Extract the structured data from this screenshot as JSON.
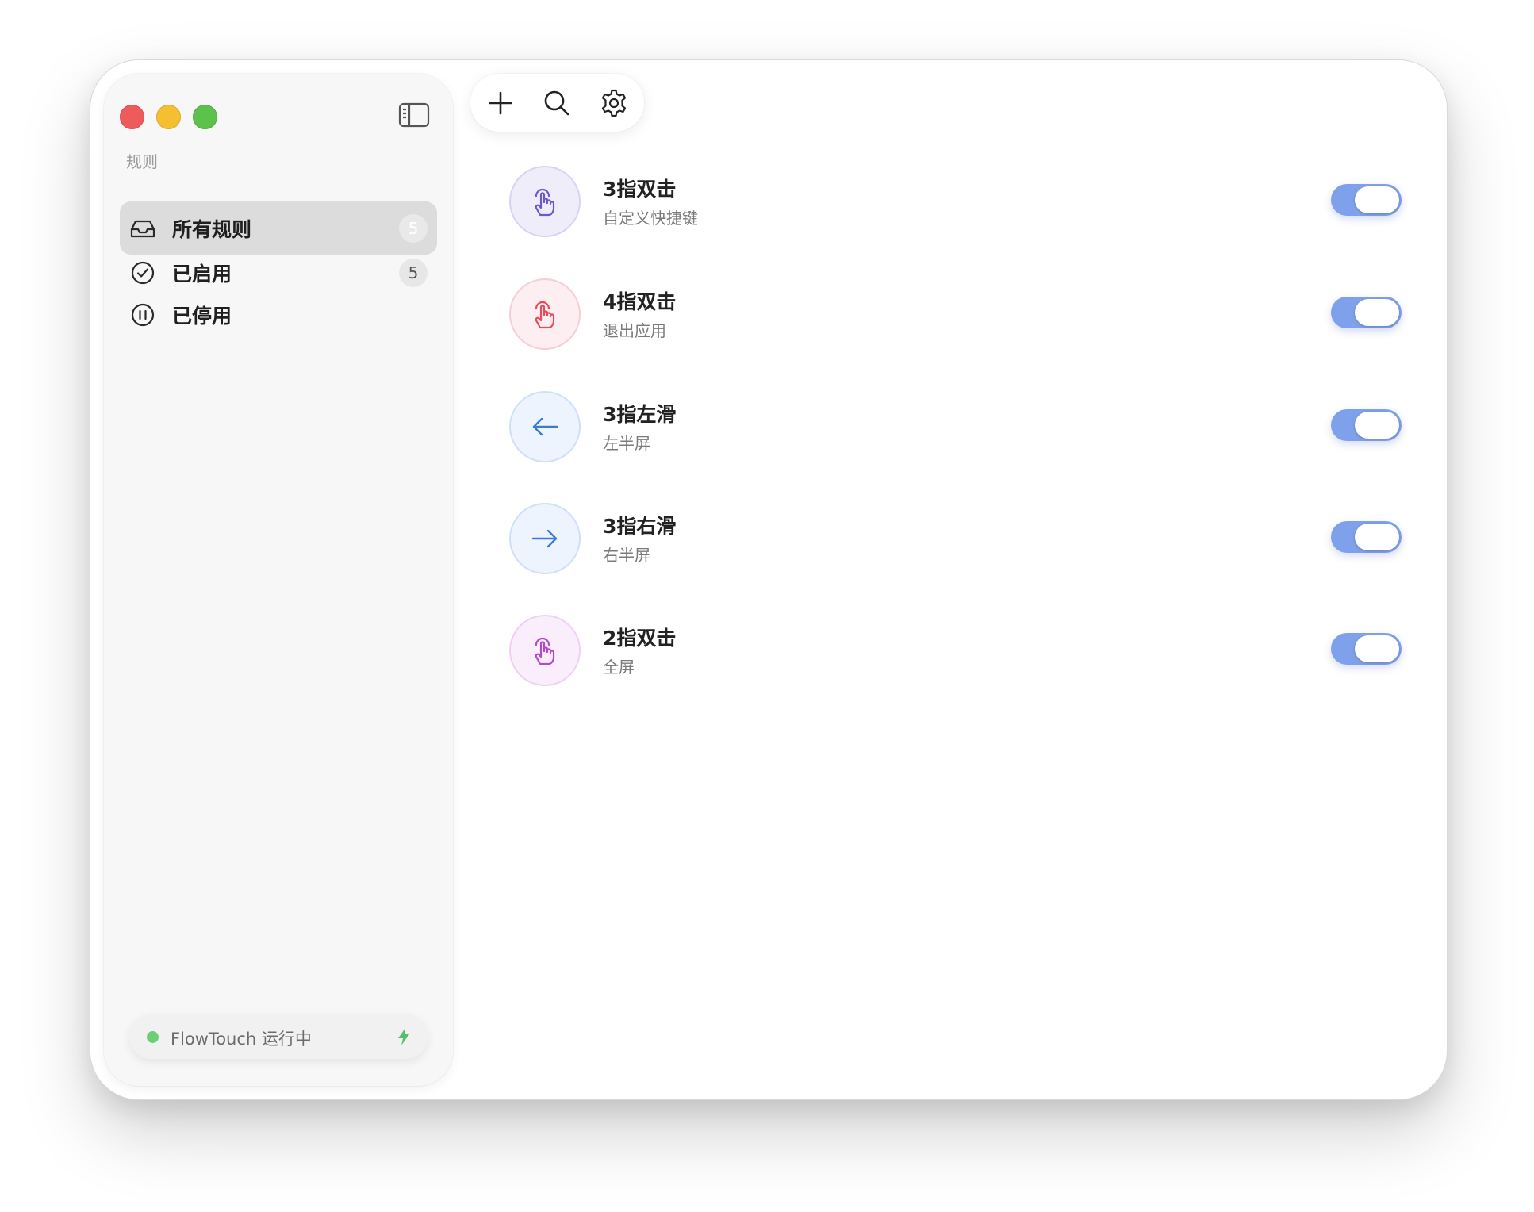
{
  "sidebar": {
    "section_label": "规则",
    "items": [
      {
        "label": "所有规则",
        "count": "5",
        "icon": "tray-icon"
      },
      {
        "label": "已启用",
        "count": "5",
        "icon": "check-circle-icon"
      },
      {
        "label": "已停用",
        "count": "",
        "icon": "pause-circle-icon"
      }
    ],
    "status": {
      "text": "FlowTouch 运行中",
      "dot_color": "#6bcf73"
    }
  },
  "toolbar": {
    "add_icon": "plus-icon",
    "search_icon": "search-icon",
    "settings_icon": "gear-icon"
  },
  "rules": [
    {
      "title": "3指双击",
      "subtitle": "自定义快捷键",
      "icon": "hand-tap-icon",
      "color": "#6a5acd",
      "bg": "#f0edfb",
      "border": "#d9d2f3",
      "enabled": true
    },
    {
      "title": "4指双击",
      "subtitle": "退出应用",
      "icon": "hand-tap-icon",
      "color": "#e64a5e",
      "bg": "#fdeff1",
      "border": "#f5cfd5",
      "enabled": true
    },
    {
      "title": "3指左滑",
      "subtitle": "左半屏",
      "icon": "arrow-left-icon",
      "color": "#3a7bd5",
      "bg": "#eef4fd",
      "border": "#cfe0f7",
      "enabled": true
    },
    {
      "title": "3指右滑",
      "subtitle": "右半屏",
      "icon": "arrow-right-icon",
      "color": "#3a7bd5",
      "bg": "#eef4fd",
      "border": "#cfe0f7",
      "enabled": true
    },
    {
      "title": "2指双击",
      "subtitle": "全屏",
      "icon": "hand-tap-icon",
      "color": "#b04cc8",
      "bg": "#fbeefc",
      "border": "#efd0f3",
      "enabled": true
    }
  ],
  "colors": {
    "accent": "#7fa0ea"
  }
}
